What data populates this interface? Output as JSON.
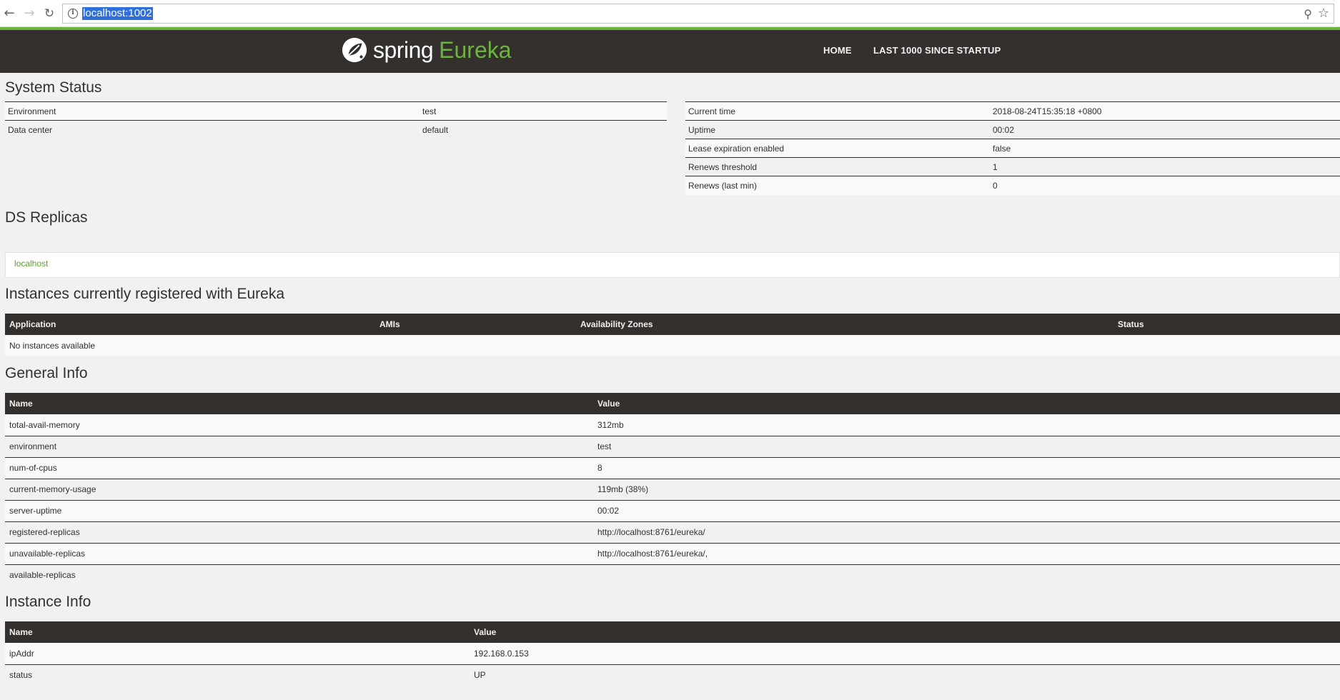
{
  "browser": {
    "url": "localhost:1002",
    "back_icon": "arrow-left-icon",
    "forward_icon": "arrow-right-icon",
    "reload_icon": "reload-icon",
    "zoom_icon": "magnifier-icon",
    "star_icon": "star-icon"
  },
  "header": {
    "brand_spring": "spring",
    "brand_eureka": "Eureka",
    "nav": {
      "home": "HOME",
      "last": "LAST 1000 SINCE STARTUP"
    },
    "accent_color": "#6db33f",
    "bar_color": "#34302d"
  },
  "system_status": {
    "title": "System Status",
    "left": [
      {
        "label": "Environment",
        "value": "test"
      },
      {
        "label": "Data center",
        "value": "default"
      }
    ],
    "right": [
      {
        "label": "Current time",
        "value": "2018-08-24T15:35:18 +0800"
      },
      {
        "label": "Uptime",
        "value": "00:02"
      },
      {
        "label": "Lease expiration enabled",
        "value": "false"
      },
      {
        "label": "Renews threshold",
        "value": "1"
      },
      {
        "label": "Renews (last min)",
        "value": "0"
      }
    ]
  },
  "ds_replicas": {
    "title": "DS Replicas",
    "items": [
      "localhost"
    ]
  },
  "instances": {
    "title": "Instances currently registered with Eureka",
    "columns": [
      "Application",
      "AMIs",
      "Availability Zones",
      "Status"
    ],
    "empty_text": "No instances available"
  },
  "general_info": {
    "title": "General Info",
    "columns": [
      "Name",
      "Value"
    ],
    "rows": [
      {
        "name": "total-avail-memory",
        "value": "312mb"
      },
      {
        "name": "environment",
        "value": "test"
      },
      {
        "name": "num-of-cpus",
        "value": "8"
      },
      {
        "name": "current-memory-usage",
        "value": "119mb (38%)"
      },
      {
        "name": "server-uptime",
        "value": "00:02"
      },
      {
        "name": "registered-replicas",
        "value": "http://localhost:8761/eureka/"
      },
      {
        "name": "unavailable-replicas",
        "value": "http://localhost:8761/eureka/,"
      },
      {
        "name": "available-replicas",
        "value": ""
      }
    ]
  },
  "instance_info": {
    "title": "Instance Info",
    "columns": [
      "Name",
      "Value"
    ],
    "rows": [
      {
        "name": "ipAddr",
        "value": "192.168.0.153"
      },
      {
        "name": "status",
        "value": "UP"
      }
    ]
  }
}
